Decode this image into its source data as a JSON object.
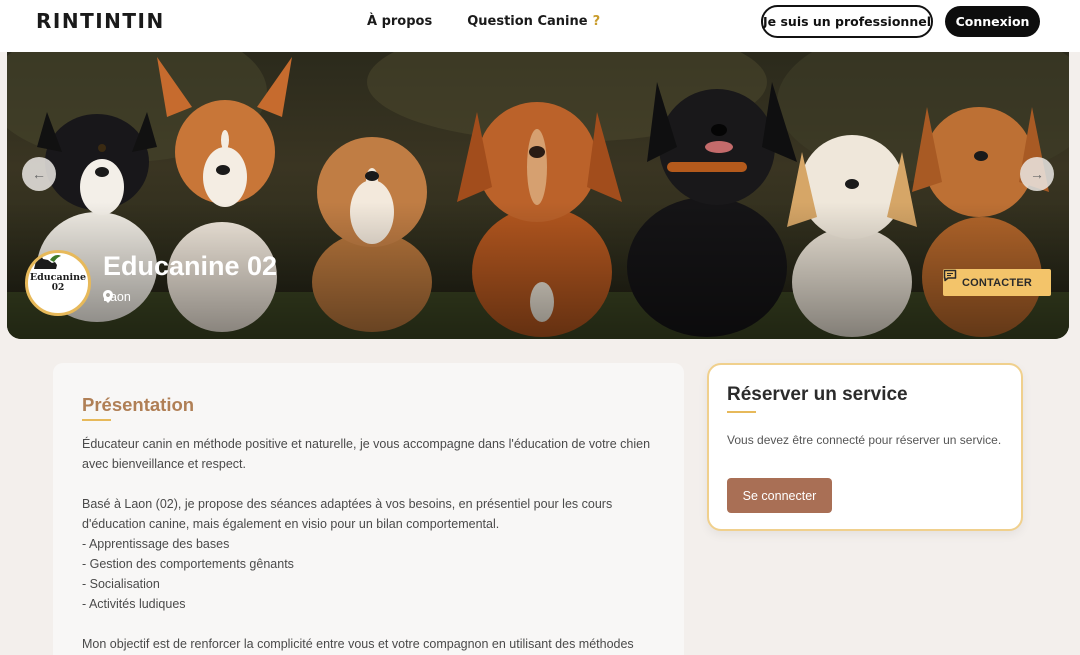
{
  "header": {
    "logo": "RINTINTIN",
    "nav": [
      {
        "label": "À propos"
      },
      {
        "label": "Question Canine",
        "suffix": "?"
      }
    ],
    "pro_button": "Je suis un professionnel",
    "login_button": "Connexion"
  },
  "hero": {
    "title": "Educanine 02",
    "location": "Laon",
    "contact_button": "CONTACTER",
    "avatar": {
      "name": "Educanine",
      "sub": "02"
    },
    "icons": {
      "prev": "arrow-left-icon",
      "next": "arrow-right-icon",
      "location": "map-pin-icon",
      "contact": "chat-icon"
    }
  },
  "presentation": {
    "title": "Présentation",
    "paragraphs": [
      "Éducateur canin en méthode positive et naturelle, je vous accompagne dans l'éducation de votre chien avec bienveillance et respect.",
      "Basé à Laon (02), je propose des séances adaptées à vos besoins, en présentiel pour les cours d'éducation canine, mais également en visio pour un bilan comportemental.",
      "- Apprentissage des bases",
      "- Gestion des comportements gênants",
      "- Socialisation",
      "- Activités ludiques",
      "Mon objectif est de renforcer la complicité entre vous et votre compagnon en utilisant des méthodes"
    ]
  },
  "booking": {
    "title": "Réserver un service",
    "text": "Vous devez être connecté pour réserver un service.",
    "button": "Se connecter"
  },
  "colors": {
    "accent_gold": "#f3c46a",
    "accent_brown": "#a96f55",
    "title_brown": "#b07f55",
    "background": "#f3efec"
  }
}
